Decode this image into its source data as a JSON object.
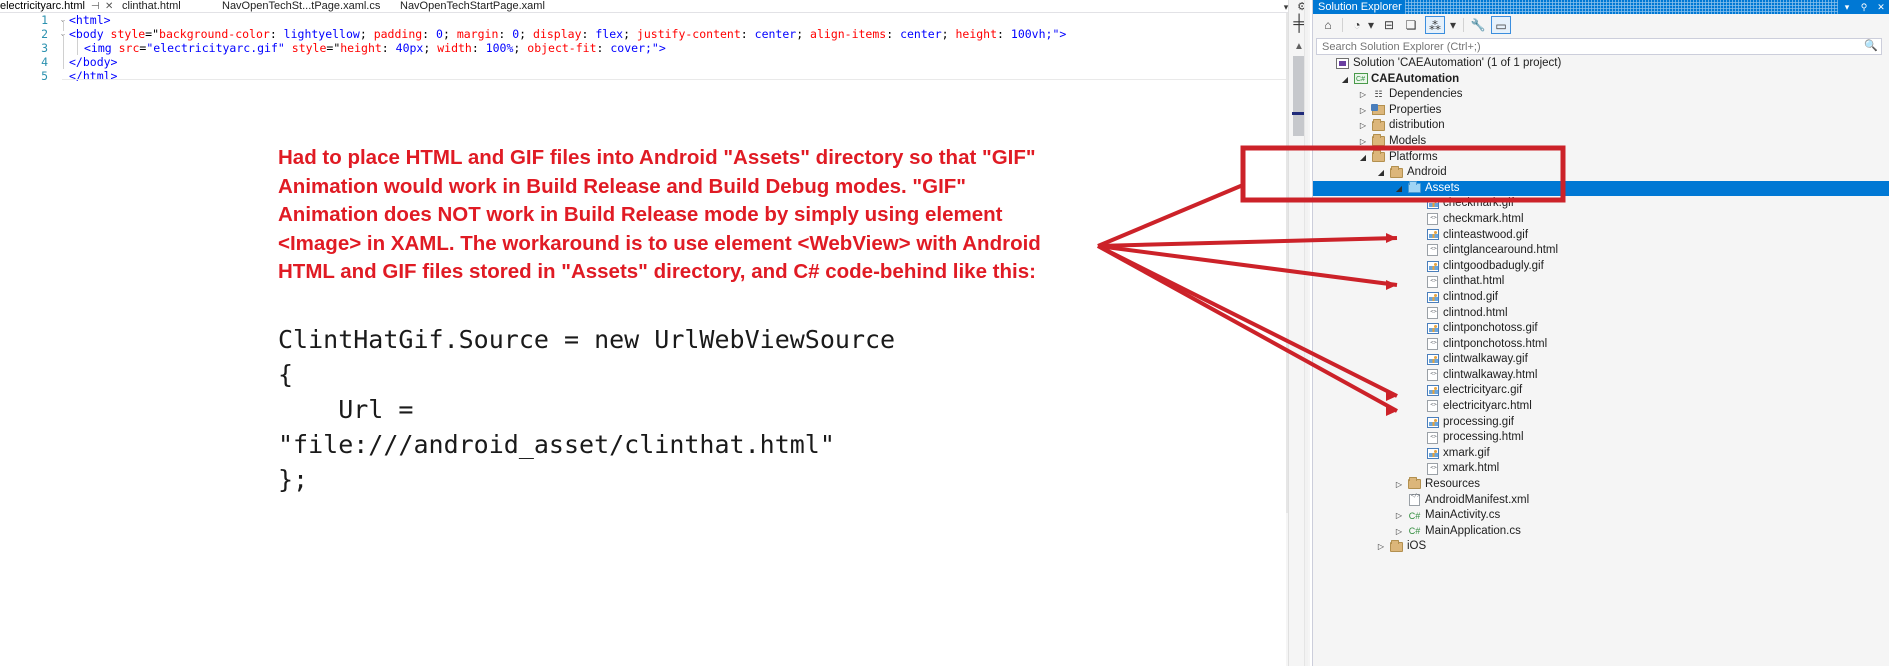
{
  "editor": {
    "tabs": [
      {
        "label": "electricityarc.html",
        "active": true,
        "pin": "⊣",
        "close": "✕"
      },
      {
        "label": "clinthat.html",
        "active": false
      },
      {
        "label": "NavOpenTechSt...tPage.xaml.cs",
        "active": false
      },
      {
        "label": "NavOpenTechStartPage.xaml",
        "active": false
      }
    ],
    "lines": [
      {
        "num": "1",
        "chevron": "⌄",
        "segments": [
          {
            "text": "<html>",
            "cls": "t-tag"
          }
        ]
      },
      {
        "num": "2",
        "chevron": "⌄",
        "segments": [
          {
            "text": "<body ",
            "cls": "t-tag"
          },
          {
            "text": "style",
            "cls": "t-attr"
          },
          {
            "text": "=\"",
            "cls": "t-punc"
          },
          {
            "text": "background-color",
            "cls": "t-prop"
          },
          {
            "text": ": ",
            "cls": "t-punc"
          },
          {
            "text": "lightyellow",
            "cls": "t-pv"
          },
          {
            "text": "; ",
            "cls": "t-punc"
          },
          {
            "text": "padding",
            "cls": "t-prop"
          },
          {
            "text": ": ",
            "cls": "t-punc"
          },
          {
            "text": "0",
            "cls": "t-pv"
          },
          {
            "text": "; ",
            "cls": "t-punc"
          },
          {
            "text": "margin",
            "cls": "t-prop"
          },
          {
            "text": ": ",
            "cls": "t-punc"
          },
          {
            "text": "0",
            "cls": "t-pv"
          },
          {
            "text": "; ",
            "cls": "t-punc"
          },
          {
            "text": "display",
            "cls": "t-prop"
          },
          {
            "text": ": ",
            "cls": "t-punc"
          },
          {
            "text": "flex",
            "cls": "t-pv"
          },
          {
            "text": "; ",
            "cls": "t-punc"
          },
          {
            "text": "justify-content",
            "cls": "t-prop"
          },
          {
            "text": ": ",
            "cls": "t-punc"
          },
          {
            "text": "center",
            "cls": "t-pv"
          },
          {
            "text": "; ",
            "cls": "t-punc"
          },
          {
            "text": "align-items",
            "cls": "t-prop"
          },
          {
            "text": ": ",
            "cls": "t-punc"
          },
          {
            "text": "center",
            "cls": "t-pv"
          },
          {
            "text": "; ",
            "cls": "t-punc"
          },
          {
            "text": "height",
            "cls": "t-prop"
          },
          {
            "text": ": ",
            "cls": "t-punc"
          },
          {
            "text": "100vh",
            "cls": "t-pv"
          },
          {
            "text": ";\">",
            "cls": "t-tag"
          }
        ]
      },
      {
        "num": "3",
        "chevron": "",
        "indent": true,
        "segments": [
          {
            "text": "<img ",
            "cls": "t-tag"
          },
          {
            "text": "src",
            "cls": "t-attr"
          },
          {
            "text": "=",
            "cls": "t-punc"
          },
          {
            "text": "\"electricityarc.gif\"",
            "cls": "t-val"
          },
          {
            "text": " ",
            "cls": "t-punc"
          },
          {
            "text": "style",
            "cls": "t-attr"
          },
          {
            "text": "=\"",
            "cls": "t-punc"
          },
          {
            "text": "height",
            "cls": "t-prop"
          },
          {
            "text": ": ",
            "cls": "t-punc"
          },
          {
            "text": "40px",
            "cls": "t-pv"
          },
          {
            "text": "; ",
            "cls": "t-punc"
          },
          {
            "text": "width",
            "cls": "t-prop"
          },
          {
            "text": ": ",
            "cls": "t-punc"
          },
          {
            "text": "100%",
            "cls": "t-pv"
          },
          {
            "text": "; ",
            "cls": "t-punc"
          },
          {
            "text": "object-fit",
            "cls": "t-prop"
          },
          {
            "text": ": ",
            "cls": "t-punc"
          },
          {
            "text": "cover",
            "cls": "t-pv"
          },
          {
            "text": ";\">",
            "cls": "t-tag"
          }
        ]
      },
      {
        "num": "4",
        "chevron": "",
        "segments": [
          {
            "text": "</body>",
            "cls": "t-tag"
          }
        ]
      },
      {
        "num": "5",
        "chevron": "",
        "segments": [
          {
            "text": "</html>",
            "cls": "t-tag"
          }
        ]
      }
    ]
  },
  "annotation": {
    "paragraph": "Had to place HTML and GIF files into Android \"Assets\" directory so that \"GIF\" Animation would work in Build Release and Build Debug modes.  \"GIF\" Animation does NOT work in Build Release mode by simply using element <Image> in XAML. The workaround is to use element <WebView> with Android HTML and GIF files stored in \"Assets\" directory, and C# code-behind like this:",
    "code": "ClintHatGif.Source = new UrlWebViewSource\n{\n    Url =\n\"file:///android_asset/clinthat.html\"\n};",
    "color": "#e01b24",
    "highlight_color": "#cc2229"
  },
  "solution_explorer": {
    "title": "Solution Explorer",
    "title_buttons": {
      "dropdown": "▾",
      "pin": "⚲",
      "close": "✕"
    },
    "toolbar_icons": [
      "home-icon",
      "pending-changes-icon",
      "dropdown-icon",
      "collapse-all-icon",
      "show-all-files-icon",
      "view-code-icon",
      "view-code-dropdown-icon",
      "properties-icon",
      "preview-selected-items-icon"
    ],
    "search": {
      "placeholder": "Search Solution Explorer (Ctrl+;)",
      "value": ""
    },
    "tree": [
      {
        "label": "Solution 'CAEAutomation' (1 of 1 project)",
        "depth": 0,
        "icon": "solution-icon",
        "expander": "",
        "bold": false,
        "selected": false
      },
      {
        "label": "CAEAutomation",
        "depth": 1,
        "icon": "csharp-project-icon",
        "expander": "◢",
        "bold": true,
        "selected": false
      },
      {
        "label": "Dependencies",
        "depth": 2,
        "icon": "dependencies-icon",
        "expander": "▷",
        "bold": false,
        "selected": false
      },
      {
        "label": "Properties",
        "depth": 2,
        "icon": "properties-folder-icon",
        "expander": "▷",
        "bold": false,
        "selected": false
      },
      {
        "label": "distribution",
        "depth": 2,
        "icon": "folder-icon",
        "expander": "▷",
        "bold": false,
        "selected": false
      },
      {
        "label": "Models",
        "depth": 2,
        "icon": "folder-icon",
        "expander": "▷",
        "bold": false,
        "selected": false
      },
      {
        "label": "Platforms",
        "depth": 2,
        "icon": "folder-icon",
        "expander": "◢",
        "bold": false,
        "selected": false
      },
      {
        "label": "Android",
        "depth": 3,
        "icon": "folder-icon",
        "expander": "◢",
        "bold": false,
        "selected": false
      },
      {
        "label": "Assets",
        "depth": 4,
        "icon": "folder-open-icon",
        "expander": "◢",
        "bold": false,
        "selected": true
      },
      {
        "label": "checkmark.gif",
        "depth": 5,
        "icon": "gif-icon",
        "expander": "",
        "bold": false,
        "selected": false
      },
      {
        "label": "checkmark.html",
        "depth": 5,
        "icon": "html-icon",
        "expander": "",
        "bold": false,
        "selected": false
      },
      {
        "label": "clinteastwood.gif",
        "depth": 5,
        "icon": "gif-icon",
        "expander": "",
        "bold": false,
        "selected": false
      },
      {
        "label": "clintglancearound.html",
        "depth": 5,
        "icon": "html-icon",
        "expander": "",
        "bold": false,
        "selected": false
      },
      {
        "label": "clintgoodbadugly.gif",
        "depth": 5,
        "icon": "gif-icon",
        "expander": "",
        "bold": false,
        "selected": false
      },
      {
        "label": "clinthat.html",
        "depth": 5,
        "icon": "html-icon",
        "expander": "",
        "bold": false,
        "selected": false
      },
      {
        "label": "clintnod.gif",
        "depth": 5,
        "icon": "gif-icon",
        "expander": "",
        "bold": false,
        "selected": false
      },
      {
        "label": "clintnod.html",
        "depth": 5,
        "icon": "html-icon",
        "expander": "",
        "bold": false,
        "selected": false
      },
      {
        "label": "clintponchotoss.gif",
        "depth": 5,
        "icon": "gif-icon",
        "expander": "",
        "bold": false,
        "selected": false
      },
      {
        "label": "clintponchotoss.html",
        "depth": 5,
        "icon": "html-icon",
        "expander": "",
        "bold": false,
        "selected": false
      },
      {
        "label": "clintwalkaway.gif",
        "depth": 5,
        "icon": "gif-icon",
        "expander": "",
        "bold": false,
        "selected": false
      },
      {
        "label": "clintwalkaway.html",
        "depth": 5,
        "icon": "html-icon",
        "expander": "",
        "bold": false,
        "selected": false
      },
      {
        "label": "electricityarc.gif",
        "depth": 5,
        "icon": "gif-icon",
        "expander": "",
        "bold": false,
        "selected": false
      },
      {
        "label": "electricityarc.html",
        "depth": 5,
        "icon": "html-icon",
        "expander": "",
        "bold": false,
        "selected": false
      },
      {
        "label": "processing.gif",
        "depth": 5,
        "icon": "gif-icon",
        "expander": "",
        "bold": false,
        "selected": false
      },
      {
        "label": "processing.html",
        "depth": 5,
        "icon": "html-icon",
        "expander": "",
        "bold": false,
        "selected": false
      },
      {
        "label": "xmark.gif",
        "depth": 5,
        "icon": "gif-icon",
        "expander": "",
        "bold": false,
        "selected": false
      },
      {
        "label": "xmark.html",
        "depth": 5,
        "icon": "html-icon",
        "expander": "",
        "bold": false,
        "selected": false
      },
      {
        "label": "Resources",
        "depth": 4,
        "icon": "folder-icon",
        "expander": "▷",
        "bold": false,
        "selected": false
      },
      {
        "label": "AndroidManifest.xml",
        "depth": 4,
        "icon": "xml-icon",
        "expander": "",
        "bold": false,
        "selected": false
      },
      {
        "label": "MainActivity.cs",
        "depth": 4,
        "icon": "csharp-file-icon",
        "expander": "▷",
        "bold": false,
        "selected": false
      },
      {
        "label": "MainApplication.cs",
        "depth": 4,
        "icon": "csharp-file-icon",
        "expander": "▷",
        "bold": false,
        "selected": false
      },
      {
        "label": "iOS",
        "depth": 3,
        "icon": "folder-icon",
        "expander": "▷",
        "bold": false,
        "selected": false
      }
    ]
  }
}
